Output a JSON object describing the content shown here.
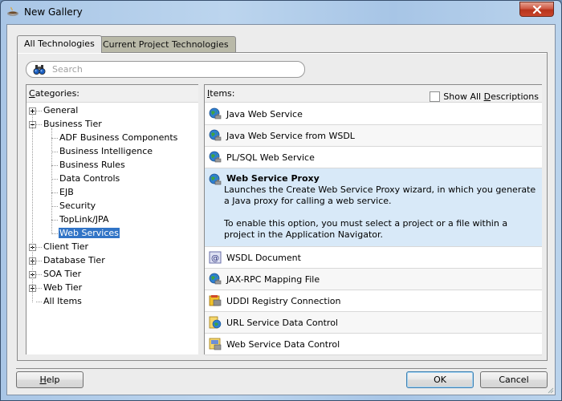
{
  "window": {
    "title": "New Gallery",
    "icon": "coffee-cup-icon"
  },
  "tabs": [
    {
      "label": "All Technologies",
      "active": true
    },
    {
      "label": "Current Project Technologies",
      "active": false
    }
  ],
  "search": {
    "placeholder": "Search",
    "value": "",
    "icon": "binoculars-icon"
  },
  "categories": {
    "header_mnemonic": "C",
    "header_rest": "ategories:",
    "tree": [
      {
        "label": "General",
        "level": 0,
        "expander": "plus"
      },
      {
        "label": "Business Tier",
        "level": 0,
        "expander": "minus"
      },
      {
        "label": "ADF Business Components",
        "level": 1
      },
      {
        "label": "Business Intelligence",
        "level": 1
      },
      {
        "label": "Business Rules",
        "level": 1
      },
      {
        "label": "Data Controls",
        "level": 1
      },
      {
        "label": "EJB",
        "level": 1
      },
      {
        "label": "Security",
        "level": 1
      },
      {
        "label": "TopLink/JPA",
        "level": 1
      },
      {
        "label": "Web Services",
        "level": 1,
        "selected": true
      },
      {
        "label": "Client Tier",
        "level": 0,
        "expander": "plus"
      },
      {
        "label": "Database Tier",
        "level": 0,
        "expander": "plus"
      },
      {
        "label": "SOA Tier",
        "level": 0,
        "expander": "plus"
      },
      {
        "label": "Web Tier",
        "level": 0,
        "expander": "plus"
      },
      {
        "label": "All Items",
        "level": 0
      }
    ]
  },
  "items": {
    "header_mnemonic": "I",
    "header_rest": "tems:",
    "show_all_descriptions": {
      "pre": "Show All ",
      "mnemonic": "D",
      "post": "escriptions",
      "checked": false
    },
    "list": [
      {
        "label": "Java Web Service",
        "icon": "web-service-globe-icon"
      },
      {
        "label": "Java Web Service from WSDL",
        "icon": "web-service-globe-icon"
      },
      {
        "label": "PL/SQL Web Service",
        "icon": "web-service-globe-icon"
      },
      {
        "label": "Web Service Proxy",
        "icon": "web-service-globe-icon",
        "selected": true,
        "description": [
          "Launches the Create Web Service Proxy wizard, in which you generate a Java proxy for calling a web service.",
          "To enable this option, you must select a project or a file within a project in the Application Navigator."
        ]
      },
      {
        "label": "WSDL Document",
        "icon": "wsdl-document-icon"
      },
      {
        "label": "JAX-RPC Mapping File",
        "icon": "web-service-globe-icon"
      },
      {
        "label": "UDDI Registry Connection",
        "icon": "uddi-registry-icon"
      },
      {
        "label": "URL Service Data Control",
        "icon": "url-data-control-icon"
      },
      {
        "label": "Web Service Data Control",
        "icon": "web-service-data-control-icon"
      }
    ]
  },
  "buttons": {
    "help": {
      "mnemonic": "H",
      "rest": "elp"
    },
    "ok": "OK",
    "cancel": "Cancel"
  },
  "colors": {
    "selection": "#3174c6",
    "selected_item_bg": "#d8e9f8",
    "titlebar": "#a9c6e6",
    "close_button": "#c9452c"
  }
}
